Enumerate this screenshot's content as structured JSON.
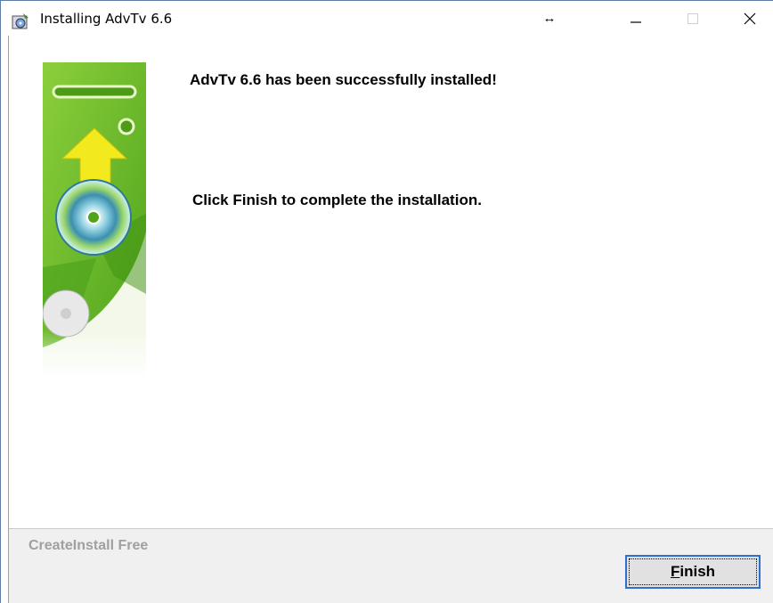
{
  "window": {
    "title": "Installing AdvTv 6.6",
    "resize_glyph": "↔",
    "controls": [
      "minimize-icon",
      "maximize-icon",
      "close-icon"
    ]
  },
  "content": {
    "headline": "AdvTv 6.6 has been successfully installed!",
    "instruction": "Click Finish to complete the installation."
  },
  "footer": {
    "brand": "CreateInstall Free",
    "finish_mnemonic": "F",
    "finish_rest": "inish"
  },
  "colors": {
    "banner_green": "#6fbf2a",
    "banner_light": "#b8e07a",
    "arrow_yellow": "#f2ea1c",
    "button_focus": "#2f6fd0"
  }
}
